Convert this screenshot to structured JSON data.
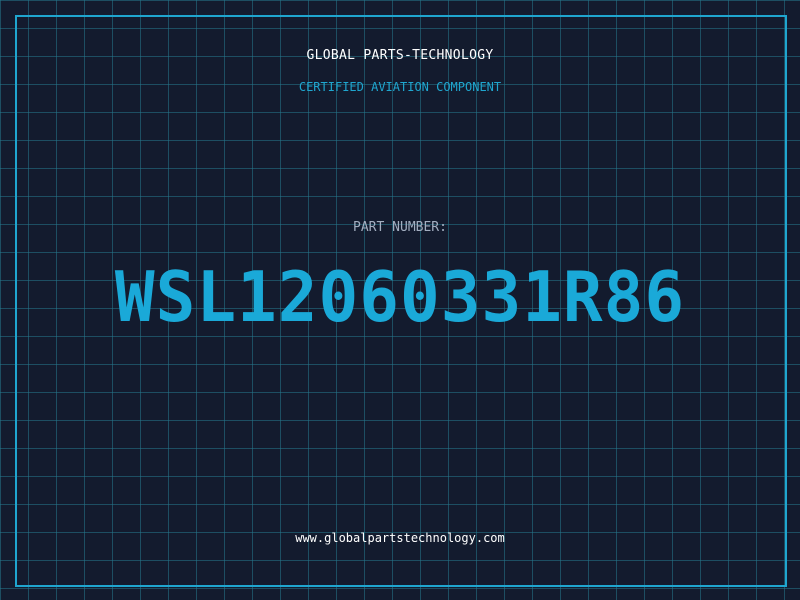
{
  "header": {
    "company": "GLOBAL PARTS-TECHNOLOGY",
    "tagline": "CERTIFIED AVIATION COMPONENT"
  },
  "part": {
    "label": "PART NUMBER:",
    "number": "WSL12060331R86"
  },
  "footer": {
    "website": "www.globalpartstechnology.com"
  },
  "colors": {
    "background": "#131b2e",
    "grid": "#24788c",
    "accent": "#1aa9d8",
    "text": "#ffffff",
    "muted": "#a3aec0"
  }
}
